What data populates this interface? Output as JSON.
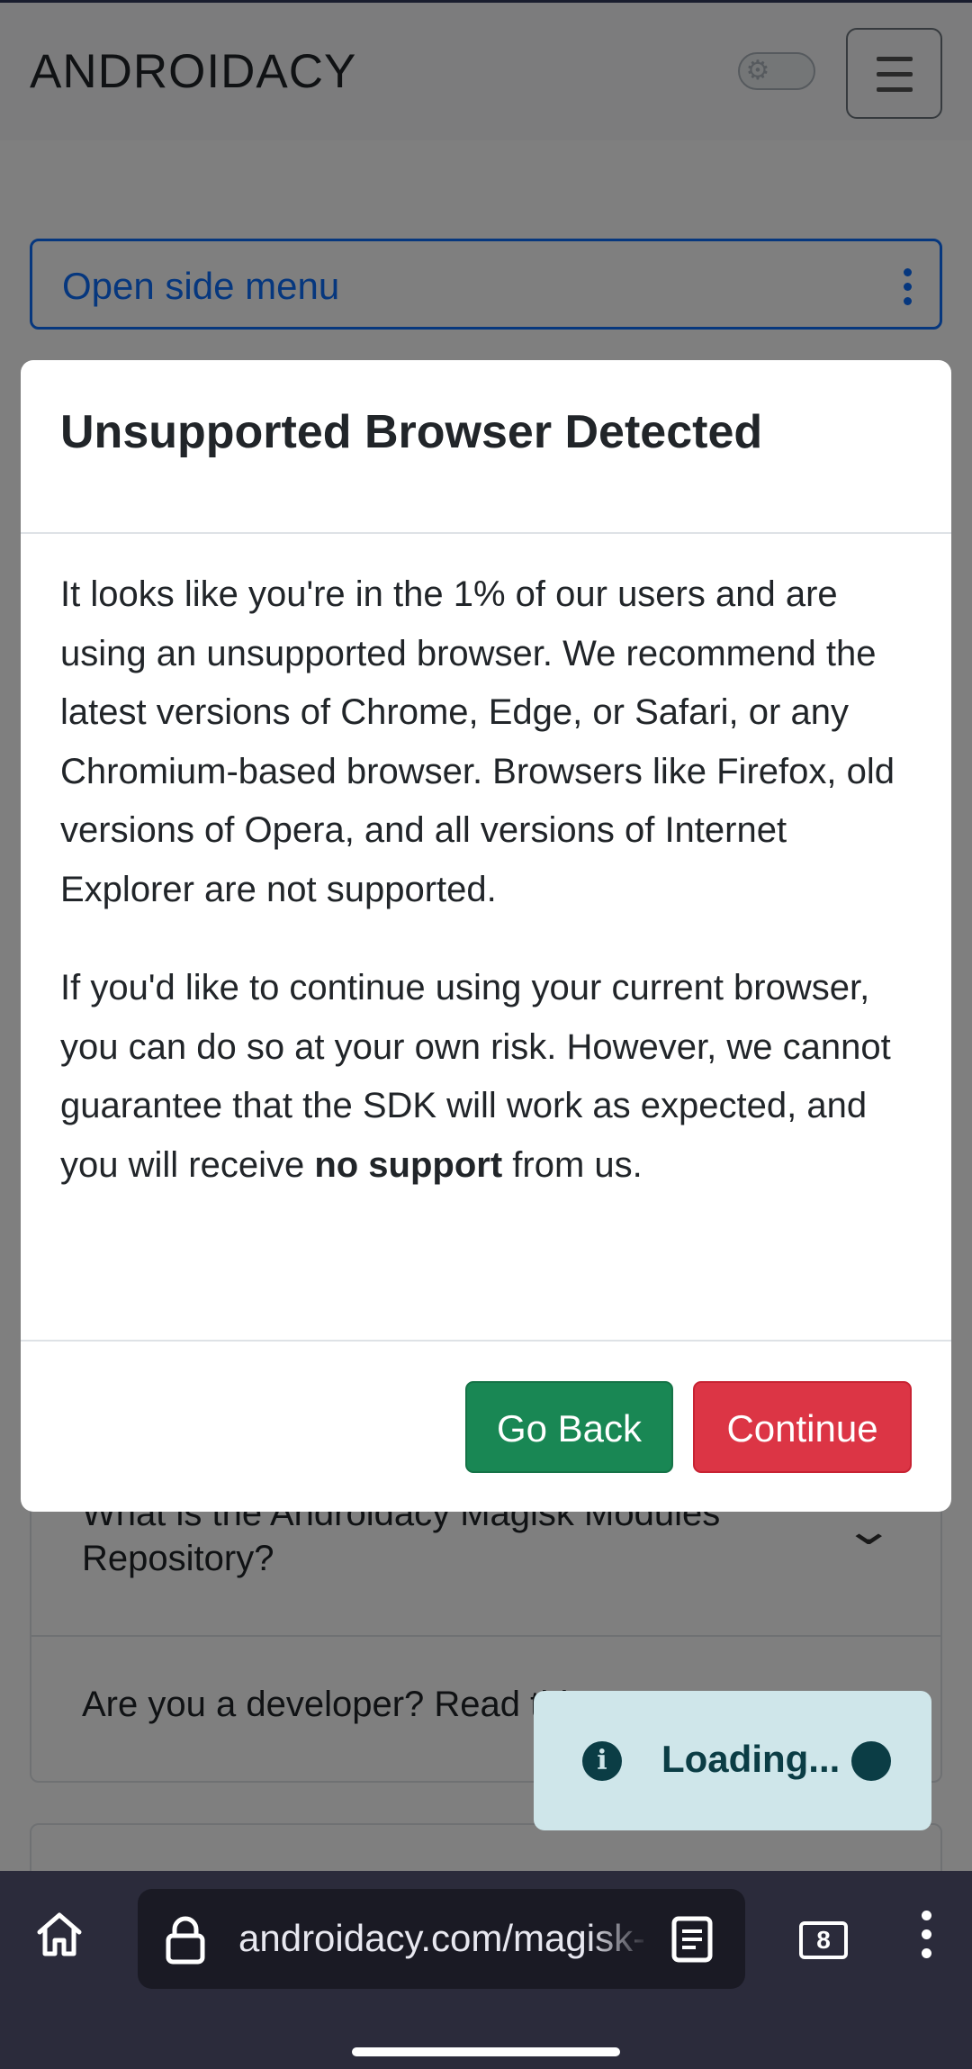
{
  "header": {
    "brand": "ANDROIDACY"
  },
  "side_menu": {
    "label": "Open side menu"
  },
  "faq": {
    "items": [
      {
        "question_line1": "What is the Androidacy Magisk Modules",
        "question_line2": "Repository?"
      },
      {
        "question": "Are you a developer? Read this!"
      }
    ]
  },
  "toast": {
    "text": "Loading..."
  },
  "modal": {
    "title": "Unsupported Browser Detected",
    "paragraph1": "It looks like you're in the 1% of our users and are using an unsupported browser. We recommend the latest versions of Chrome, Edge, or Safari, or any Chromium-based browser. Browsers like Firefox, old versions of Opera, and all versions of Internet Explorer are not supported.",
    "paragraph2_before": "If you'd like to continue using your current browser, you can do so at your own risk. However, we cannot guarantee that the SDK will work as expected, and you will receive ",
    "paragraph2_bold": "no support",
    "paragraph2_after": " from us.",
    "go_back_label": "Go Back",
    "continue_label": "Continue"
  },
  "browser": {
    "url": "androidacy.com/magisk-",
    "tab_count": "8"
  },
  "colors": {
    "primary": "#0d6efd",
    "success": "#198754",
    "danger": "#dc3545",
    "chrome_bg": "#2b2b3b",
    "toast_bg": "#cfe6ea"
  }
}
